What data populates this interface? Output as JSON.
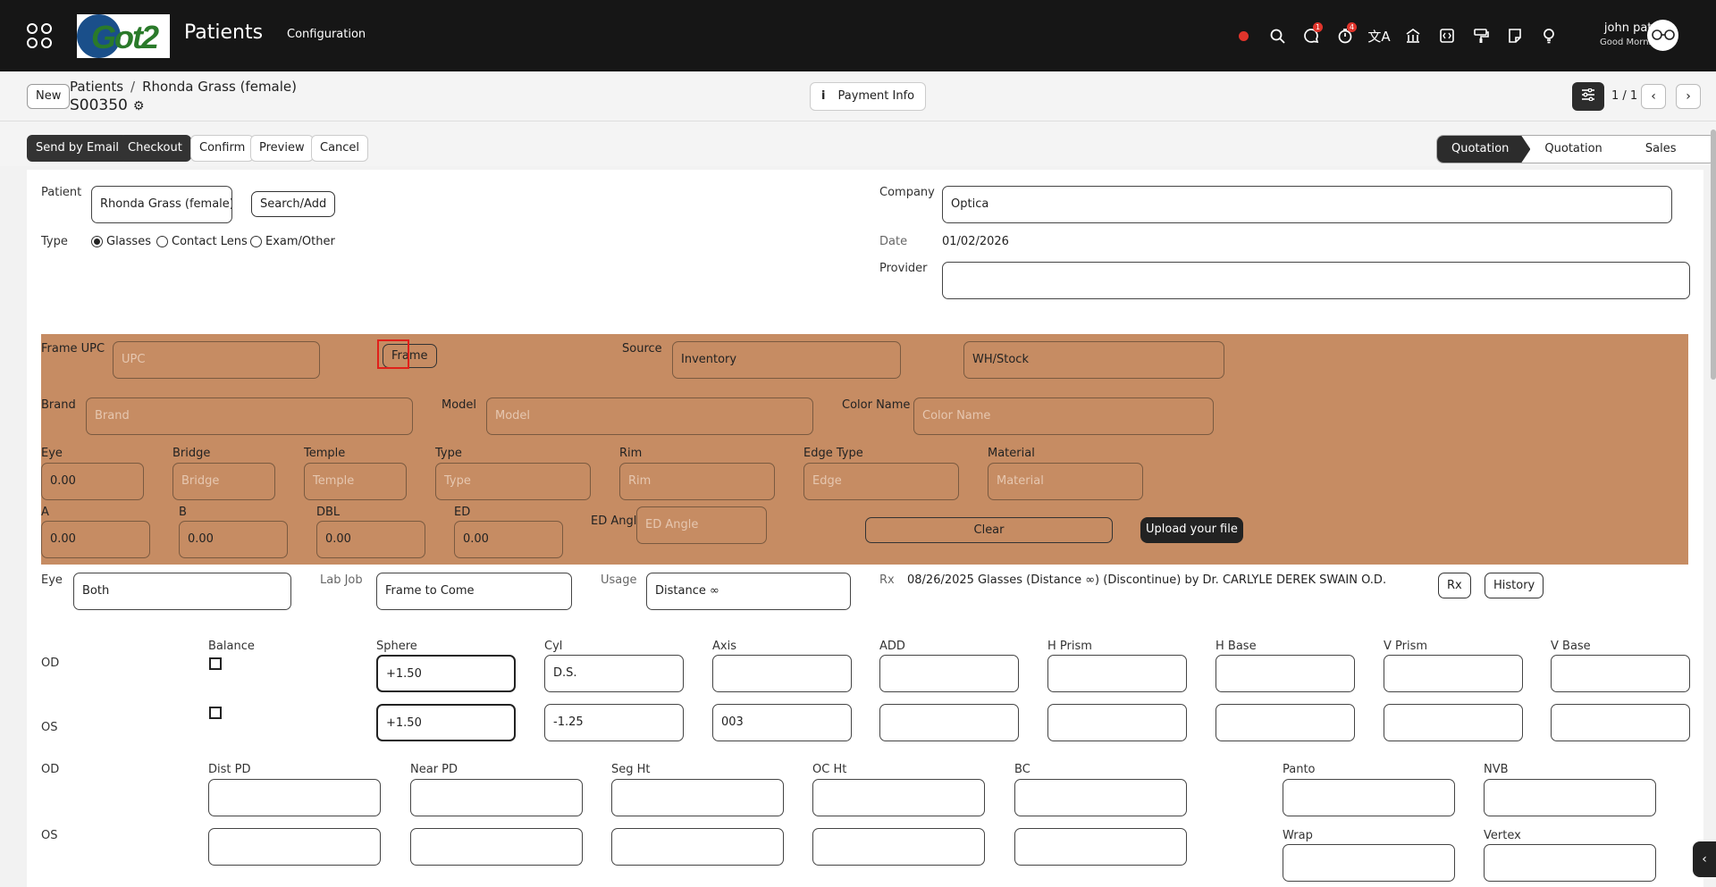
{
  "topbar": {
    "app_title": "Patients",
    "nav_config": "Configuration",
    "icons": [
      "record-icon",
      "search-icon",
      "chat-icon",
      "timer-icon",
      "translate-icon",
      "bank-icon",
      "code-icon",
      "paint-icon",
      "note-icon",
      "lightbulb-icon"
    ],
    "chat_badge": "1",
    "timer_badge": "4",
    "user_name": "john patel",
    "user_greeting": "Good Morning",
    "logo_text": "Got2"
  },
  "crumbbar": {
    "new_label": "New",
    "crumb_root": "Patients",
    "crumb_sep": "/",
    "crumb_current": "Rhonda Grass (female)",
    "record_id": "S00350",
    "payment_info": "Payment Info",
    "pager": "1 / 1"
  },
  "actions": {
    "send_email": "Send by Email",
    "checkout": "Checkout",
    "confirm": "Confirm",
    "preview": "Preview",
    "cancel": "Cancel"
  },
  "stages": [
    "Quotation",
    "Quotation Sent",
    "Sales Order"
  ],
  "form": {
    "patient_label": "Patient",
    "patient_value": "Rhonda Grass (female)",
    "search_add": "Search/Add",
    "type_label": "Type",
    "type_options": [
      "Glasses",
      "Contact Lens",
      "Exam/Other"
    ],
    "type_selected": "Glasses",
    "company_label": "Company",
    "company_value": "Optica",
    "date_label": "Date",
    "date_value": "01/02/2026",
    "provider_label": "Provider",
    "provider_value": ""
  },
  "frame": {
    "upc_label": "Frame UPC",
    "upc_placeholder": "UPC",
    "frame_button": "Frame",
    "source_label": "Source",
    "source_value": "Inventory",
    "wh_value": "WH/Stock",
    "brand_label": "Brand",
    "brand_placeholder": "Brand",
    "model_label": "Model",
    "model_placeholder": "Model",
    "color_label": "Color Name",
    "color_placeholder": "Color Name",
    "eye_label": "Eye",
    "eye_value": "0.00",
    "bridge_label": "Bridge",
    "bridge_placeholder": "Bridge",
    "temple_label": "Temple",
    "temple_placeholder": "Temple",
    "type_label": "Type",
    "type_placeholder": "Type",
    "rim_label": "Rim",
    "rim_placeholder": "Rim",
    "edge_label": "Edge Type",
    "edge_placeholder": "Edge",
    "material_label": "Material",
    "material_placeholder": "Material",
    "a_label": "A",
    "a_value": "0.00",
    "b_label": "B",
    "b_value": "0.00",
    "dbl_label": "DBL",
    "dbl_value": "0.00",
    "ed_label": "ED",
    "ed_value": "0.00",
    "ed_angle_label": "ED Angle",
    "ed_angle_placeholder": "ED Angle",
    "clear": "Clear",
    "upload": "Upload your file"
  },
  "lens": {
    "eye_label": "Eye",
    "eye_value": "Both",
    "labjob_label": "Lab Job",
    "labjob_value": "Frame to Come",
    "usage_label": "Usage",
    "usage_value": "Distance ∞",
    "rx_label": "Rx",
    "rx_value": "08/26/2025 Glasses (Distance ∞) (Discontinue) by Dr. CARLYLE DEREK SWAIN O.D.",
    "rx_button": "Rx",
    "history_button": "History"
  },
  "rx_grid": {
    "od": "OD",
    "os": "OS",
    "balance": "Balance",
    "headers": [
      "Sphere",
      "Cyl",
      "Axis",
      "ADD",
      "H Prism",
      "H Base",
      "V Prism",
      "V Base"
    ],
    "od_values": [
      "+1.50",
      "D.S.",
      "",
      "",
      "",
      "",
      "",
      ""
    ],
    "os_values": [
      "+1.50",
      "-1.25",
      "003",
      "",
      "",
      "",
      "",
      ""
    ]
  },
  "measure": {
    "od": "OD",
    "os": "OS",
    "headers": [
      "Dist PD",
      "Near PD",
      "Seg Ht",
      "OC Ht",
      "BC"
    ],
    "panto": "Panto",
    "nvb": "NVB",
    "wrap": "Wrap",
    "vertex": "Vertex"
  }
}
